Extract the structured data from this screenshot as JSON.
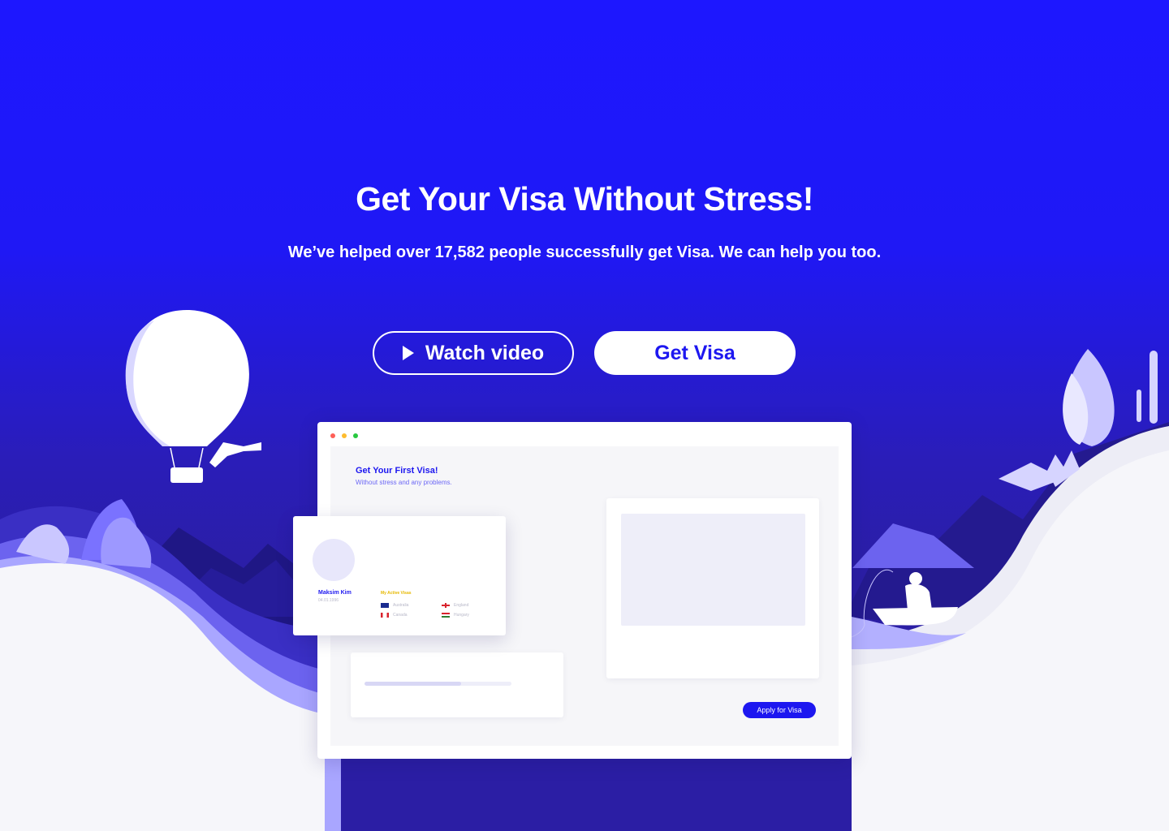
{
  "hero": {
    "headline": "Get Your Visa Without Stress!",
    "subline": "We’ve helped over 17,582 people successfully get Visa. We can help you too.",
    "watch_video_label": "Watch video",
    "get_visa_label": "Get Visa"
  },
  "mockup": {
    "title": "Get Your First Visa!",
    "subtitle": "Without stress and any problems.",
    "apply_label": "Apply for Visa",
    "progress": 0.66,
    "profile": {
      "name": "Maksim Kim",
      "date": "04.01.1996",
      "visas_label": "My Active Visas",
      "visas": [
        {
          "country": "Australia",
          "flag": "australia-flag-icon"
        },
        {
          "country": "England",
          "flag": "england-flag-icon"
        },
        {
          "country": "Canada",
          "flag": "canada-flag-icon"
        },
        {
          "country": "Hungary",
          "flag": "hungary-flag-icon"
        }
      ]
    }
  },
  "colors": {
    "brand": "#1d17f0",
    "background_top": "#1d17ff",
    "background_bottom": "#2b1ea4",
    "ground": "#f6f6fa",
    "accent_light": "#a9a6ff"
  }
}
